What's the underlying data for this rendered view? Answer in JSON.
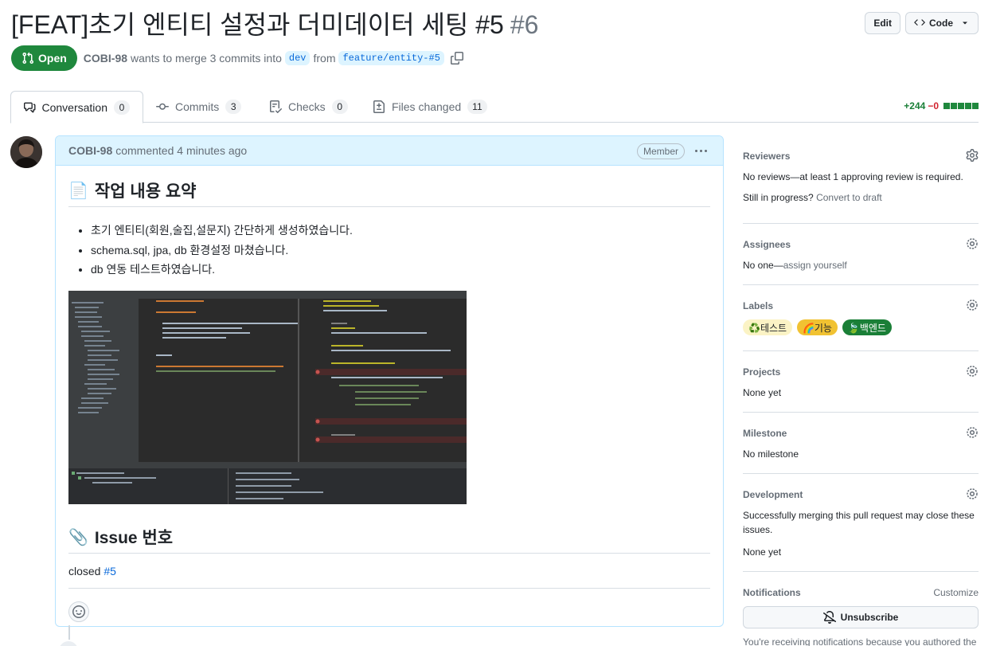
{
  "header": {
    "title": "[FEAT]초기 엔티티 설정과 더미데이터 세팅 #5",
    "number": "#6",
    "edit_label": "Edit",
    "code_label": "Code"
  },
  "meta": {
    "state": "Open",
    "author": "COBI-98",
    "text_merge": "wants to merge 3 commits into",
    "base_branch": "dev",
    "text_from": "from",
    "head_branch": "feature/entity-#5"
  },
  "tabs": [
    {
      "label": "Conversation",
      "count": "0",
      "icon": "comment-discussion-icon"
    },
    {
      "label": "Commits",
      "count": "3",
      "icon": "git-commit-icon"
    },
    {
      "label": "Checks",
      "count": "0",
      "icon": "checklist-icon"
    },
    {
      "label": "Files changed",
      "count": "11",
      "icon": "file-diff-icon"
    }
  ],
  "diffstat": {
    "additions": "+244",
    "deletions": "−0"
  },
  "comment": {
    "author": "COBI-98",
    "action": "commented 4 minutes ago",
    "role": "Member",
    "summary_emoji": "📄",
    "summary_heading": "작업 내용 요약",
    "items": [
      "초기 엔티티(회원,술집,설문지) 간단하게 생성하였습니다.",
      "schema.sql, jpa, db 환경설정 마쳤습니다.",
      "db 연동 테스트하였습니다."
    ],
    "issue_emoji": "📎",
    "issue_heading": "Issue 번호",
    "closed_text": "closed",
    "closed_ref": "#5"
  },
  "sidebar": {
    "reviewers": {
      "heading": "Reviewers",
      "text": "No reviews—at least 1 approving review is required.",
      "progress_prefix": "Still in progress?",
      "progress_link": "Convert to draft"
    },
    "assignees": {
      "heading": "Assignees",
      "text_prefix": "No one—",
      "text_link": "assign yourself"
    },
    "labels": {
      "heading": "Labels",
      "items": [
        {
          "name": "♻️테스트",
          "bg": "#fbf3c5",
          "fg": "#1f2328"
        },
        {
          "name": "🌈기능",
          "bg": "#f1c232",
          "fg": "#1f2328"
        },
        {
          "name": "🍃백엔드",
          "bg": "#1a7f37",
          "fg": "#ffffff"
        }
      ]
    },
    "projects": {
      "heading": "Projects",
      "text": "None yet"
    },
    "milestone": {
      "heading": "Milestone",
      "text": "No milestone"
    },
    "development": {
      "heading": "Development",
      "text": "Successfully merging this pull request may close these issues.",
      "none": "None yet"
    },
    "notifications": {
      "heading": "Notifications",
      "customize": "Customize",
      "button": "Unsubscribe",
      "footer": "You're receiving notifications because you authored the"
    }
  },
  "colors": {
    "open_green": "#1f883d",
    "link_blue": "#0969da",
    "header_blue": "#ddf4ff"
  }
}
